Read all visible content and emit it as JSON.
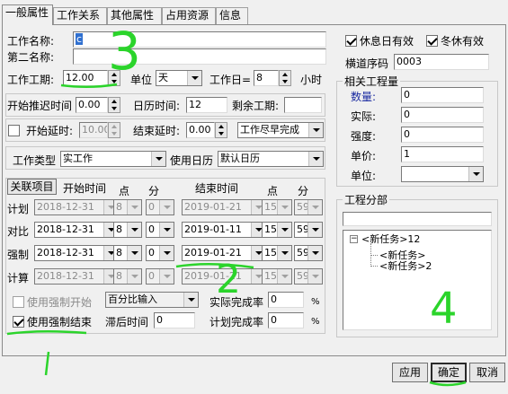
{
  "tabs": [
    "一般属性",
    "工作关系",
    "其他属性",
    "占用资源",
    "信息"
  ],
  "left": {
    "name_label": "工作名称:",
    "name_value": "c",
    "name2_label": "第二名称:",
    "name2_value": "",
    "duration_label": "工作工期:",
    "duration_value": "12.00",
    "unit_label": "单位",
    "unit_value": "天",
    "workdays_label": "工作日=",
    "workdays_value": "8",
    "hours_label": "小时",
    "startdelay_label": "开始推迟时间",
    "startdelay_value": "0.00",
    "calendar_time_label": "日历时间:",
    "calendar_time_value": "12",
    "remaining_label": "剩余工期:",
    "remaining_value": "",
    "start_lag_label": "开始延时:",
    "start_lag_value": "10.00",
    "end_lag_label": "结束延时:",
    "end_lag_value": "0.00",
    "finish_mode_value": "工作尽早完成",
    "worktype_label": "工作类型",
    "worktype_value": "实工作",
    "use_calendar_label": "使用日历",
    "use_calendar_value": "默认日历",
    "related_tab": "关联项目",
    "col_start": "开始时间",
    "col_point": "点",
    "col_min": "分",
    "col_end": "结束时间",
    "col_point2": "点",
    "col_min2": "分",
    "rows": [
      {
        "label": "计划",
        "start": "2018-12-31",
        "sh": "8",
        "sm": "0",
        "end": "2019-01-21",
        "eh": "15",
        "em": "59",
        "disabled": true
      },
      {
        "label": "对比",
        "start": "2018-12-31",
        "sh": "8",
        "sm": "0",
        "end": "2019-01-11",
        "eh": "15",
        "em": "59",
        "disabled": false
      },
      {
        "label": "强制",
        "start": "2018-12-31",
        "sh": "8",
        "sm": "0",
        "end": "2019-01-21",
        "eh": "15",
        "em": "59",
        "disabled": false
      },
      {
        "label": "计算",
        "start": "2018-12-31",
        "sh": "8",
        "sm": "0",
        "end": "2019-01-21",
        "eh": "15",
        "em": "59",
        "disabled": true
      }
    ],
    "force_start_label": "使用强制开始",
    "percent_input_value": "百分比输入",
    "actual_rate_label": "实际完成率",
    "actual_rate_value": "0",
    "pct": "%",
    "force_end_label": "使用强制结束",
    "lag_time_label": "滞后时间",
    "lag_time_value": "0",
    "plan_rate_label": "计划完成率",
    "plan_rate_value": "0"
  },
  "right": {
    "rest_valid_label": "休息日有效",
    "winter_valid_label": "冬休有效",
    "order_label": "横道序码",
    "order_value": "0003",
    "qty_group": "相关工程量",
    "qty_label": "数量:",
    "qty_value": "0",
    "actual_label": "实际:",
    "actual_value": "0",
    "intensity_label": "强度:",
    "intensity_value": "0",
    "price_label": "单价:",
    "price_value": "1",
    "unit_label": "单位:",
    "unit_value": "",
    "branch_group": "工程分部",
    "tree": [
      "<新任务>12",
      "<新任务>",
      "<新任务>2"
    ]
  },
  "footer": {
    "apply": "应用",
    "ok": "确定",
    "cancel": "取消"
  },
  "annotations": [
    "3",
    "2",
    "1",
    "4"
  ]
}
